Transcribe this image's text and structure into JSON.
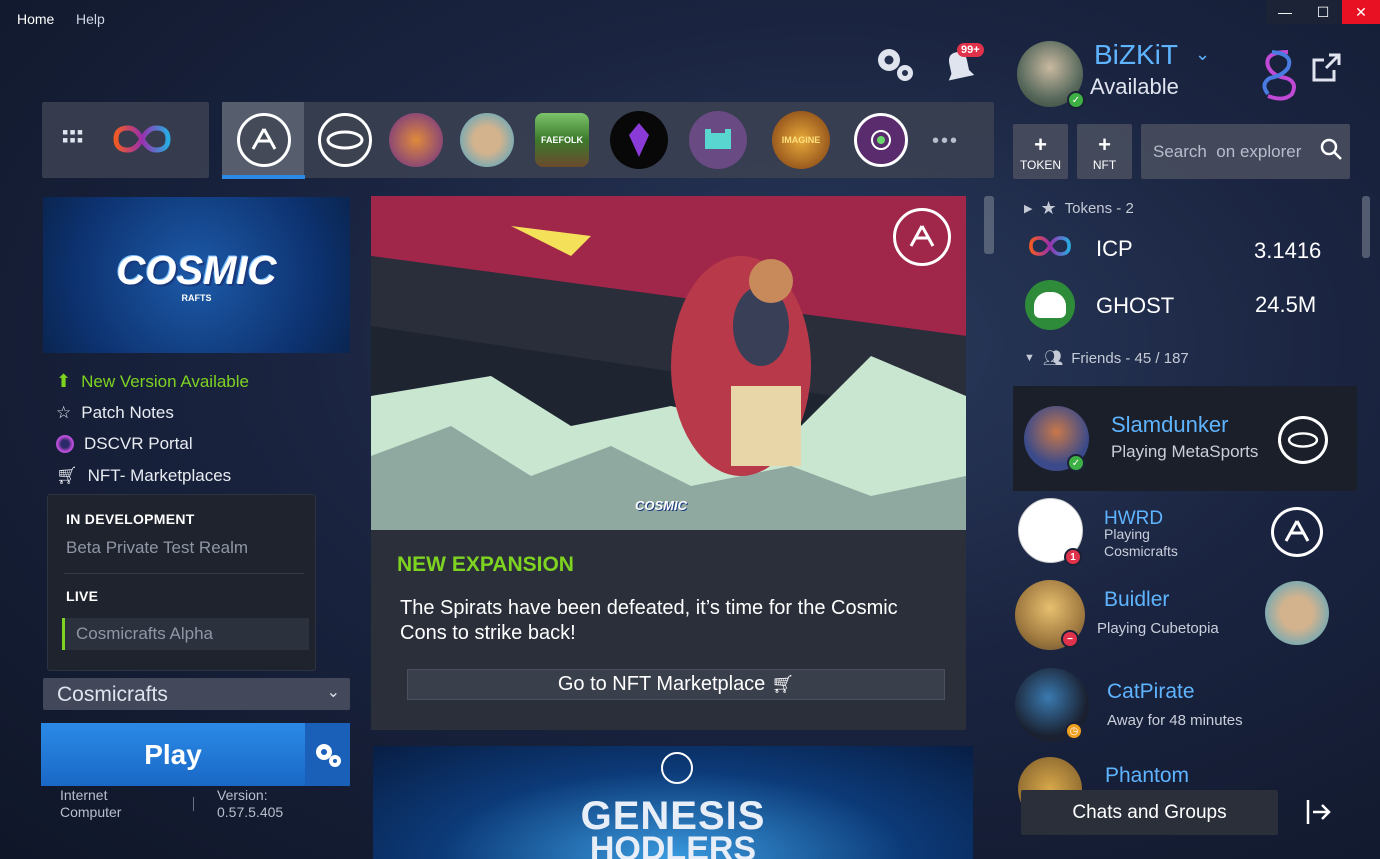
{
  "menu": {
    "home": "Home",
    "help": "Help"
  },
  "window_controls": {
    "minimize": "—",
    "maximize": "☐",
    "close": "✕"
  },
  "notifications": {
    "badge": "99+"
  },
  "user": {
    "name": "BiZKiT",
    "status": "Available"
  },
  "games_tabs": [
    {
      "name": "cosmicrafts"
    },
    {
      "name": "metasports"
    },
    {
      "name": "game-3"
    },
    {
      "name": "cubetopia"
    },
    {
      "name": "faefolk",
      "label": "FAEFOLK"
    },
    {
      "name": "crystal"
    },
    {
      "name": "cat-game"
    },
    {
      "name": "imagine",
      "label": "IMAGINE"
    },
    {
      "name": "game-9"
    }
  ],
  "more_label": "•••",
  "actions": {
    "token_label": "TOKEN",
    "nft_label": "NFT",
    "search_placeholder": "Search  on explorer"
  },
  "game": {
    "logo_title": "COSMIC",
    "logo_sub": "RAFTS",
    "links": [
      {
        "label": "New Version Available",
        "color": "#7ed321"
      },
      {
        "label": "Patch Notes"
      },
      {
        "label": "DSCVR Portal"
      },
      {
        "label": "NFT- Marketplaces"
      }
    ],
    "realms": {
      "in_dev_heading": "IN DEVELOPMENT",
      "in_dev_item": "Beta Private Test Realm",
      "live_heading": "LIVE",
      "live_item": "Cosmicrafts Alpha"
    },
    "selected": "Cosmicrafts",
    "play_label": "Play",
    "platform": "Internet Computer",
    "version": "Version: 0.57.5.405"
  },
  "feature": {
    "logo_text": "COSMIC",
    "tag": "NEW EXPANSION",
    "text": "The Spirats have been defeated, it’s time for the Cosmic Cons to strike back!",
    "cta": "Go to NFT Marketplace"
  },
  "banner": {
    "title": "GENESIS",
    "subtitle": "HODLERS"
  },
  "tokens": {
    "heading": "Tokens - 2",
    "items": [
      {
        "name": "ICP",
        "value": "3.1416"
      },
      {
        "name": "GHOST",
        "value": "24.5M"
      }
    ]
  },
  "friends": {
    "heading": "Friends - 45 / 187",
    "items": [
      {
        "name": "Slamdunker",
        "status": "Playing MetaSports"
      },
      {
        "name": "HWRD",
        "status": "Playing Cosmicrafts"
      },
      {
        "name": "Buidler",
        "status": "Playing Cubetopia"
      },
      {
        "name": "CatPirate",
        "status": "Away for 48 minutes"
      },
      {
        "name": "Phantom",
        "status": ""
      }
    ],
    "badge_hwrd": "1"
  },
  "chats_label": "Chats and Groups",
  "colors": {
    "accent": "#2b8ae6",
    "link": "#5fb4ff",
    "new": "#7ed321",
    "tag": "#7ed321"
  }
}
